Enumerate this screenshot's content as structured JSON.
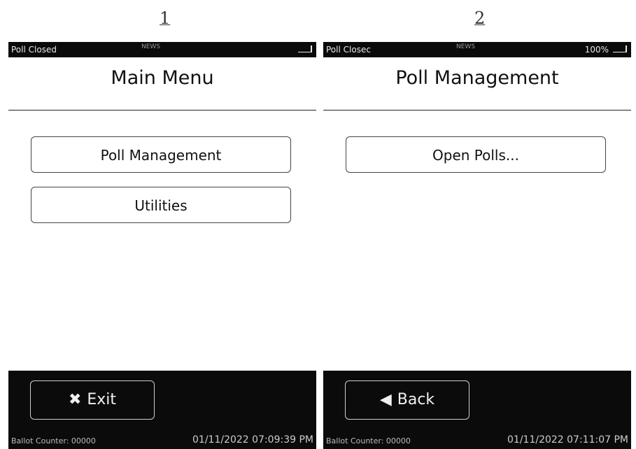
{
  "screens": [
    {
      "step": "1",
      "status_left": "Poll Closed",
      "status_center": "NEWS",
      "status_right": "",
      "title": "Main Menu",
      "buttons": [
        "Poll Management",
        "Utilities"
      ],
      "footer_button": {
        "icon": "close-icon",
        "glyph": "✖",
        "label": "Exit"
      },
      "footer_left": "Ballot Counter: 00000",
      "footer_right": "01/11/2022 07:09:39 PM"
    },
    {
      "step": "2",
      "status_left": "Poll Closec",
      "status_center": "NEWS",
      "status_right": "100%",
      "title": "Poll Management",
      "buttons": [
        "Open Polls..."
      ],
      "footer_button": {
        "icon": "back-arrow-icon",
        "glyph": "◀",
        "label": "Back"
      },
      "footer_left": "Ballot Counter: 00000",
      "footer_right": "01/11/2022 07:11:07 PM"
    }
  ],
  "colors": {
    "status_bar": "#0a0a0a",
    "footer": "#0b0b0b",
    "background": "#ffffff"
  }
}
